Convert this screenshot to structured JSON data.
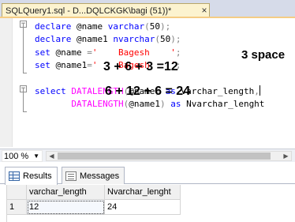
{
  "tab": {
    "title": "SQLQuery1.sql - D...DQLCKGK\\bagi (51))*",
    "close_label": "×"
  },
  "code": {
    "line1": {
      "kw1": "declare",
      "var": "@name",
      "type": "varchar",
      "p1": "(",
      "num": "50",
      "p2": ");"
    },
    "line2": {
      "kw1": "declare",
      "var": "@name1",
      "type": "nvarchar",
      "p1": "(",
      "num": "50",
      "p2": ");"
    },
    "line3": {
      "kw1": "set",
      "var": "@name",
      "eq": "=",
      "lit": "'    Bagesh    '",
      "semi": ";"
    },
    "line4": {
      "kw1": "set",
      "var": "@name1",
      "eq": "=",
      "lit": "'    Bagesh    '",
      "semi": ";"
    },
    "line5": {
      "kw1": "select",
      "fn": "DATALENGTH",
      "p1": "(",
      "var": "@name",
      "p2": ")",
      "kw2": "as",
      "alias": "varchar_length",
      "comma": ","
    },
    "line6": {
      "fn": "DATALENGTH",
      "p1": "(",
      "var": "@name1",
      "p2": ")",
      "kw2": "as",
      "alias": "Nvarchar_lenght"
    }
  },
  "annotations": {
    "spaces": "3 space",
    "equation1": "3 +   6 + 3 =12",
    "equation2": "6 + 12 + 6 = 24"
  },
  "zoom": {
    "value": "100 %"
  },
  "result_tabs": [
    {
      "label": "Results"
    },
    {
      "label": "Messages"
    }
  ],
  "results_grid": {
    "columns": [
      "varchar_length",
      "Nvarchar_lenght"
    ],
    "rows": [
      {
        "row_number": "1",
        "cells": [
          "12",
          "24"
        ]
      }
    ]
  },
  "colors": {
    "keyword": "#0000ff",
    "function": "#ff00ff",
    "string": "#ff0000",
    "operator": "#808080",
    "active_tab": "#fcf3cf"
  }
}
